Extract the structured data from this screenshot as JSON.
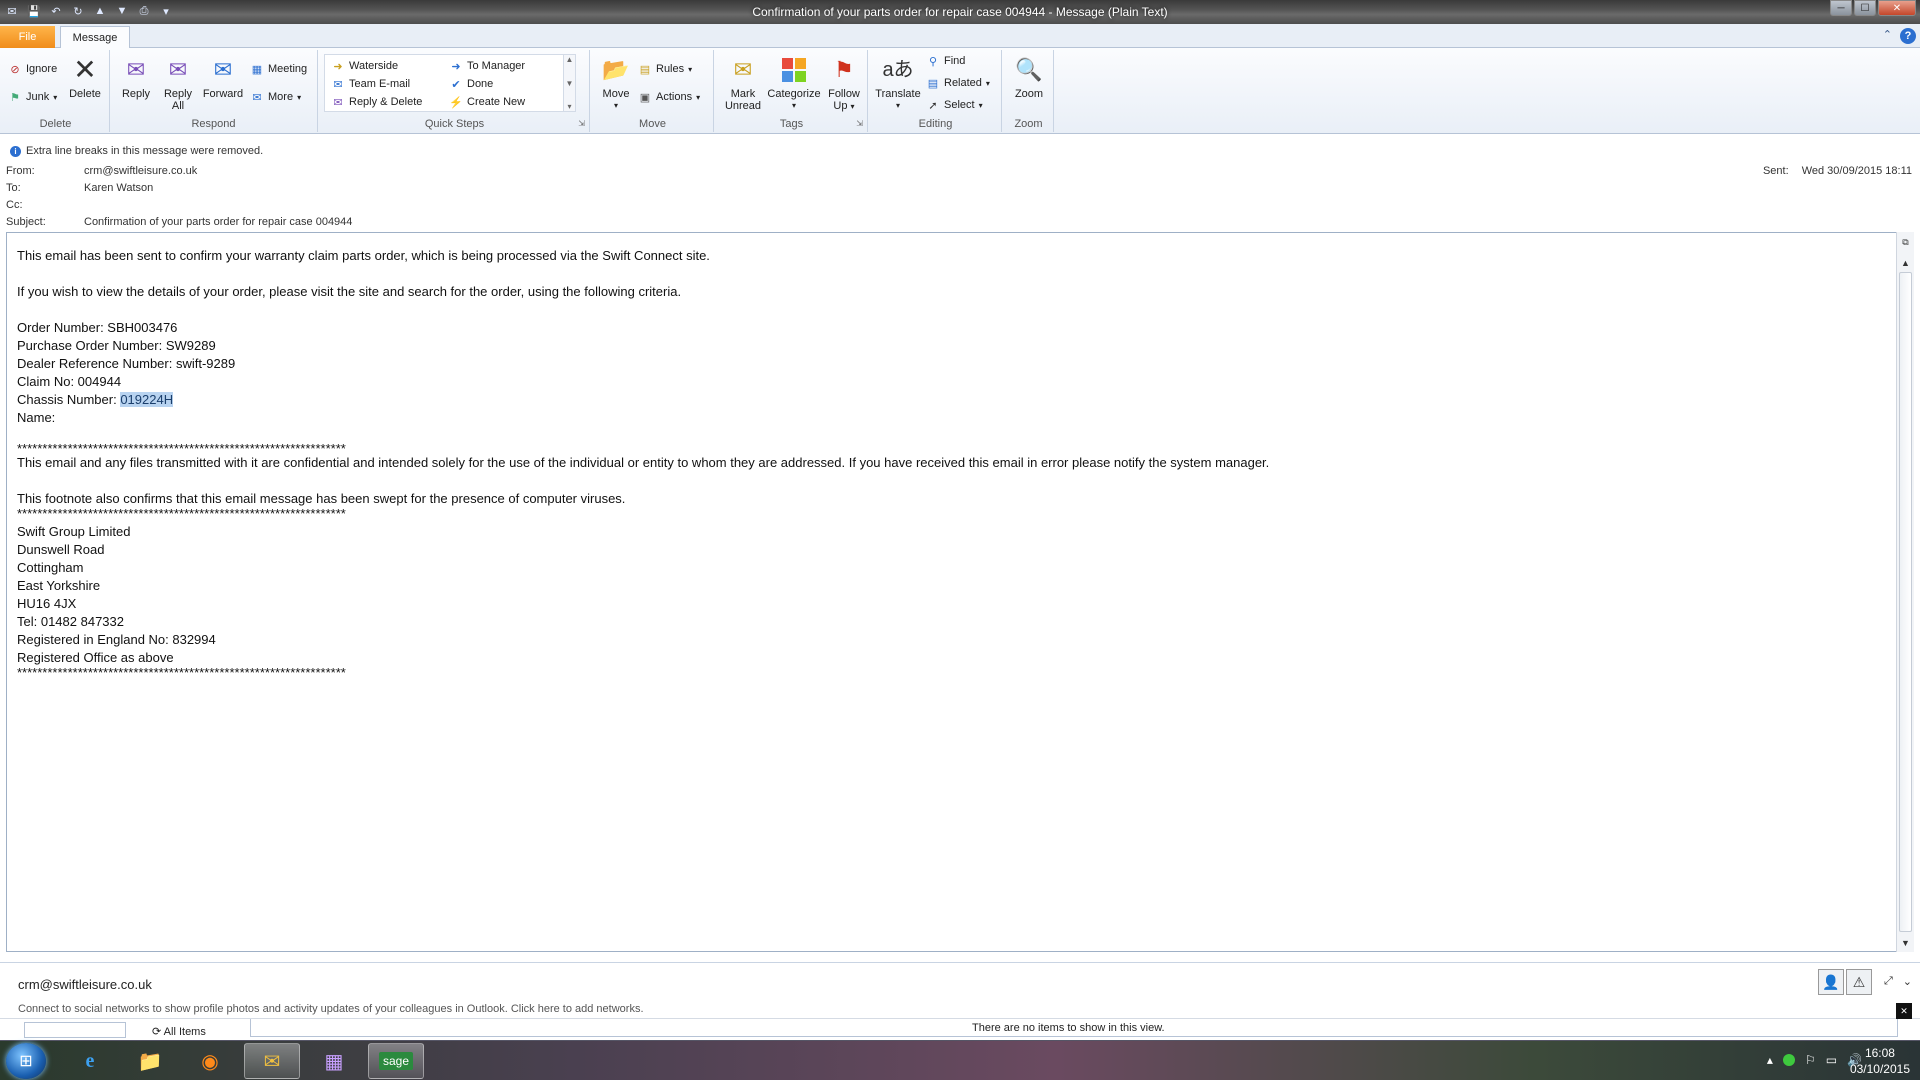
{
  "window": {
    "title": "Confirmation of your parts order for repair case 004944  -  Message (Plain Text)"
  },
  "tabs": {
    "file": "File",
    "message": "Message"
  },
  "ribbon": {
    "delete_group": {
      "label": "Delete",
      "ignore": "Ignore",
      "junk": "Junk",
      "delete": "Delete"
    },
    "respond_group": {
      "label": "Respond",
      "reply": "Reply",
      "reply_all_1": "Reply",
      "reply_all_2": "All",
      "forward": "Forward",
      "meeting": "Meeting",
      "more": "More"
    },
    "quicksteps_group": {
      "label": "Quick Steps",
      "items": [
        "Waterside",
        "Team E-mail",
        "Reply & Delete",
        "To Manager",
        "Done",
        "Create New"
      ]
    },
    "move_group": {
      "label": "Move",
      "move": "Move",
      "rules": "Rules",
      "actions": "Actions"
    },
    "tags_group": {
      "label": "Tags",
      "mark_unread_1": "Mark",
      "mark_unread_2": "Unread",
      "categorize": "Categorize",
      "follow_up_1": "Follow",
      "follow_up_2": "Up"
    },
    "editing_group": {
      "label": "Editing",
      "translate": "Translate",
      "find": "Find",
      "related": "Related",
      "select": "Select"
    },
    "zoom_group": {
      "label": "Zoom",
      "zoom": "Zoom"
    }
  },
  "info_bar": "Extra line breaks in this message were removed.",
  "headers": {
    "from_label": "From:",
    "from": "crm@swiftleisure.co.uk",
    "to_label": "To:",
    "to": "Karen Watson",
    "cc_label": "Cc:",
    "cc": "",
    "subject_label": "Subject:",
    "subject": "Confirmation of your parts order for repair case 004944",
    "sent_label": "Sent:",
    "sent": "Wed 30/09/2015 18:11"
  },
  "body": {
    "line1": "This email has been sent to confirm your warranty claim parts order, which is being processed via the Swift Connect site.",
    "line2": "If you wish to view the details of your order, please visit the site and search for the order, using the following criteria.",
    "order_number": "Order Number: SBH003476",
    "po_number": "Purchase Order Number: SW9289",
    "dealer_ref": "Dealer Reference Number: swift-9289",
    "claim_no": "Claim No: 004944",
    "chassis_label": "Chassis Number: ",
    "chassis_value": "019224H",
    "name": "Name:",
    "stars": "*****************************************************************",
    "disclaimer": "This email and any files transmitted with it are confidential and intended solely for the use of the individual or entity to whom they are addressed. If you have received this email in error please notify the system manager.",
    "footnote": "This footnote also confirms that this email message has been swept for the presence of computer viruses.",
    "address": [
      "Swift Group Limited",
      "Dunswell Road",
      "Cottingham",
      "East Yorkshire",
      "HU16 4JX",
      "Tel: 01482 847332",
      "Registered in England No: 832994",
      "Registered Office as above"
    ]
  },
  "people_pane": {
    "name": "crm@swiftleisure.co.uk",
    "hint": "Connect to social networks to show profile photos and activity updates of your colleagues in Outlook. Click here to add networks."
  },
  "bottom": {
    "all_items": "All Items",
    "no_items": "There are no items to show in this view."
  },
  "taskbar": {
    "time": "16:08",
    "date": "03/10/2015",
    "sage_label": "sage"
  }
}
